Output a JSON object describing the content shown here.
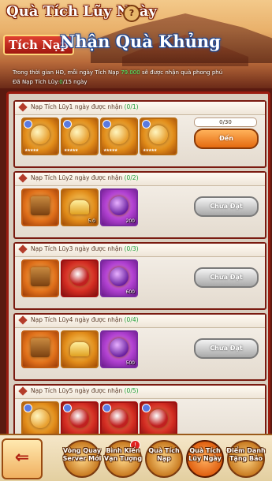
{
  "header": {
    "title": "Quà Tích Lũy Ngày",
    "tag": "Tích Nạp",
    "headline": "Nhận Quà Khủng",
    "desc_prefix": "Trong thời gian HĐ, mỗi ngày Tích Nạp",
    "desc_amount": "79.000",
    "desc_suffix": "sẽ được nhận quà phong phú",
    "progress_prefix": "Đã Nạp Tích Lũy:",
    "progress_current": "0",
    "progress_total": "/15 ngày"
  },
  "cards": [
    {
      "title_prefix": "Nạp Tích Lũy",
      "days": "1",
      "title_suffix": "ngày được nhận",
      "count": "(0/1)",
      "progress": "0/30",
      "button": "Đến"
    },
    {
      "title_prefix": "Nạp Tích Lũy",
      "days": "2",
      "title_suffix": "ngày được nhận",
      "count": "(0/2)",
      "button": "Chưa Đạt"
    },
    {
      "title_prefix": "Nạp Tích Lũy",
      "days": "3",
      "title_suffix": "ngày được nhận",
      "count": "(0/3)",
      "button": "Chưa Đạt"
    },
    {
      "title_prefix": "Nạp Tích Lũy",
      "days": "4",
      "title_suffix": "ngày được nhận",
      "count": "(0/4)",
      "button": "Chưa Đạt"
    },
    {
      "title_prefix": "Nạp Tích Lũy",
      "days": "5",
      "title_suffix": "ngày được nhận",
      "count": "(0/5)"
    }
  ],
  "items": {
    "row2": [
      "",
      "5.0",
      "200"
    ],
    "row3": [
      "",
      "",
      "600"
    ],
    "row4": [
      "",
      "",
      "500"
    ]
  },
  "nav": {
    "back": "⇐",
    "tabs": [
      {
        "label": "Vòng Quay Server Mới"
      },
      {
        "label": "Bình Kiến Vạn Tượng",
        "badge": "!"
      },
      {
        "label": "Quà Tích Nạp"
      },
      {
        "label": "Quà Tích Lũy Ngày"
      },
      {
        "label": "Điểm Danh Tặng Bảo"
      }
    ]
  },
  "colors": {
    "accent": "#9a1c10",
    "highlight": "#1fa03a",
    "go_button": "#e46a10"
  }
}
